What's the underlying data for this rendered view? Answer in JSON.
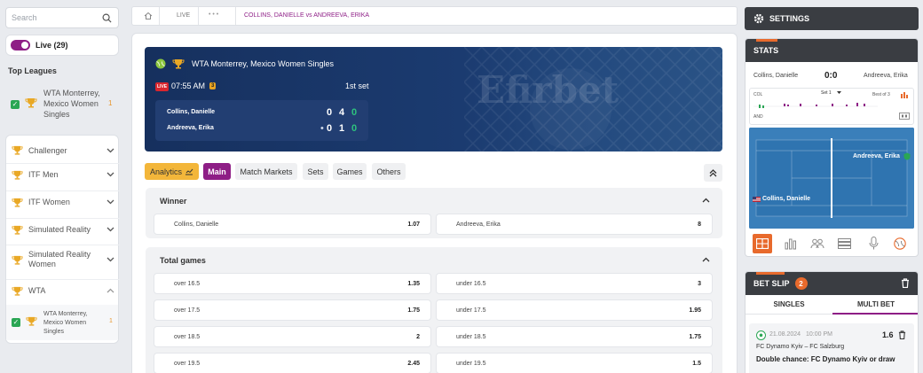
{
  "sidebar": {
    "search_placeholder": "Search",
    "live_label": "Live (29)",
    "top_leagues_title": "Top Leagues",
    "top_league": {
      "name": "WTA Monterrey, Mexico Women Singles",
      "count": "1"
    },
    "categories": [
      {
        "name": "Challenger"
      },
      {
        "name": "ITF Men"
      },
      {
        "name": "ITF Women"
      },
      {
        "name": "Simulated Reality"
      },
      {
        "name": "Simulated Reality Women"
      },
      {
        "name": "WTA"
      }
    ],
    "wta_sub": {
      "name": "WTA Monterrey, Mexico Women Singles",
      "count": "1"
    }
  },
  "breadcrumb": {
    "live": "LIVE",
    "dots": "• • •",
    "match": "COLLINS, DANIELLE vs ANDREEVA, ERIKA"
  },
  "banner": {
    "tournament": "WTA Monterrey, Mexico Women Singles",
    "live_badge": "LIVE",
    "time": "07:55 AM",
    "tv_badge": "3",
    "set": "1st set",
    "watermark": "Efirbet",
    "players": [
      {
        "name": "Collins, Danielle",
        "serve": "",
        "sets": "0",
        "games": "4",
        "points": "0"
      },
      {
        "name": "Andreeva, Erika",
        "serve": "•",
        "sets": "0",
        "games": "1",
        "points": "0"
      }
    ]
  },
  "tabs": [
    "Analytics",
    "Main",
    "Match Markets",
    "Sets",
    "Games",
    "Others"
  ],
  "winner": {
    "title": "Winner",
    "odds": [
      {
        "label": "Collins, Danielle",
        "value": "1.07"
      },
      {
        "label": "Andreeva, Erika",
        "value": "8"
      }
    ]
  },
  "total_games": {
    "title": "Total games",
    "rows": [
      {
        "over": "over 16.5",
        "over_v": "1.35",
        "under": "under 16.5",
        "under_v": "3"
      },
      {
        "over": "over 17.5",
        "over_v": "1.75",
        "under": "under 17.5",
        "under_v": "1.95"
      },
      {
        "over": "over 18.5",
        "over_v": "2",
        "under": "under 18.5",
        "under_v": "1.75"
      },
      {
        "over": "over 19.5",
        "over_v": "2.45",
        "under": "under 19.5",
        "under_v": "1.5"
      }
    ]
  },
  "settings": {
    "label": "SETTINGS"
  },
  "stats": {
    "title": "STATS",
    "p1": "Collins, Danielle",
    "score": "0:0",
    "p2": "Andreeva, Erika",
    "col": "COL",
    "and": "AND",
    "set_select": "Set 1",
    "best_of": "Best of 3",
    "court_p1": "Collins, Danielle",
    "court_p2": "Andreeva, Erika"
  },
  "bet_slip": {
    "title": "BET SLIP",
    "count": "2",
    "tab_singles": "SINGLES",
    "tab_multi": "MULTI BET",
    "bet": {
      "date": "21.08.2024",
      "time": "10:00 PM",
      "odd": "1.6",
      "match": "FC Dynamo Kyiv – FC Salzburg",
      "market": "Double chance: FC Dynamo Kyiv or draw"
    }
  },
  "colors": {
    "accent_purple": "#8e1e86",
    "accent_orange": "#e86a2c",
    "analytics_yellow": "#f3b63a",
    "banner_navy": "#1b3b70",
    "green": "#2aa654"
  }
}
